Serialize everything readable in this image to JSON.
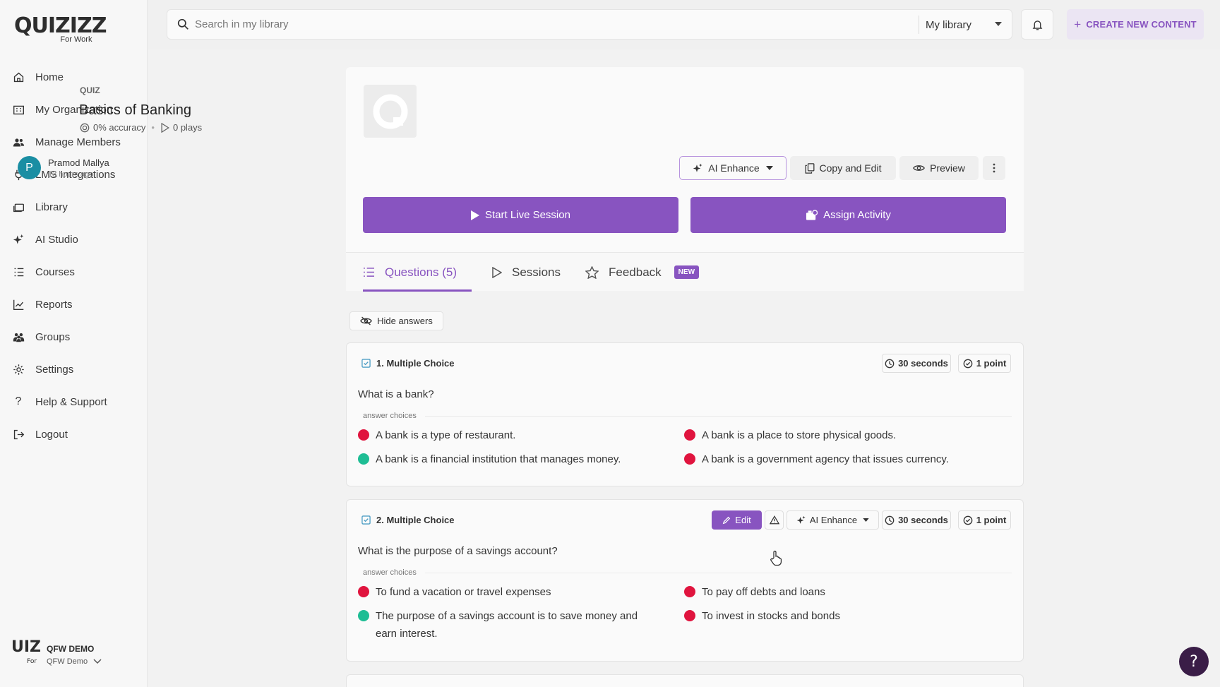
{
  "brand": {
    "logo": "QUIZIZZ",
    "subtitle": "For Work"
  },
  "sidebar": {
    "items": [
      {
        "label": "Home",
        "icon": "home-icon"
      },
      {
        "label": "My Organization",
        "icon": "organization-icon"
      },
      {
        "label": "Manage Members",
        "icon": "members-icon"
      },
      {
        "label": "LMS Integrations",
        "icon": "plug-icon"
      },
      {
        "label": "Library",
        "icon": "library-icon"
      },
      {
        "label": "AI Studio",
        "icon": "sparkle-icon"
      },
      {
        "label": "Courses",
        "icon": "courses-icon"
      },
      {
        "label": "Reports",
        "icon": "chart-icon"
      },
      {
        "label": "Groups",
        "icon": "groups-icon"
      },
      {
        "label": "Settings",
        "icon": "gear-icon"
      },
      {
        "label": "Help & Support",
        "icon": "question-icon"
      },
      {
        "label": "Logout",
        "icon": "logout-icon"
      }
    ],
    "org": {
      "logo": "UIZI",
      "logo_sub": "For",
      "name": "QFW DEMO",
      "account": "QFW Demo"
    }
  },
  "topbar": {
    "search_placeholder": "Search in my library",
    "scope": "My library",
    "create_label": "CREATE NEW CONTENT"
  },
  "quiz": {
    "type": "QUIZ",
    "title": "Basics of Banking",
    "accuracy": "0% accuracy",
    "plays": "0 plays",
    "author_initial": "P",
    "author": "Pramod Mallya",
    "updated": "13 hours ago",
    "ai_enhance": "AI Enhance",
    "copy_edit": "Copy and Edit",
    "preview": "Preview",
    "start_live": "Start Live Session",
    "assign": "Assign Activity"
  },
  "tabs": {
    "questions": "Questions (5)",
    "sessions": "Sessions",
    "feedback": "Feedback",
    "new_badge": "NEW"
  },
  "hide_answers": "Hide answers",
  "questions": [
    {
      "header": "1. Multiple Choice",
      "time": "30 seconds",
      "points": "1 point",
      "text": "What is a bank?",
      "choices_label": "answer choices",
      "choices": [
        {
          "text": "A bank is a type of restaurant.",
          "correct": false
        },
        {
          "text": "A bank is a place to store physical goods.",
          "correct": false
        },
        {
          "text": "A bank is a financial institution that manages money.",
          "correct": true
        },
        {
          "text": "A bank is a government agency that issues currency.",
          "correct": false
        }
      ]
    },
    {
      "header": "2. Multiple Choice",
      "edit": "Edit",
      "ai_enhance": "AI Enhance",
      "time": "30 seconds",
      "points": "1 point",
      "text": "What is the purpose of a savings account?",
      "choices_label": "answer choices",
      "choices": [
        {
          "text": "To fund a vacation or travel expenses",
          "correct": false
        },
        {
          "text": "To pay off debts and loans",
          "correct": false
        },
        {
          "text": "The purpose of a savings account is to save money and earn interest.",
          "correct": true
        },
        {
          "text": "To invest in stocks and bonds",
          "correct": false
        }
      ]
    }
  ],
  "help_fab": "?",
  "colors": {
    "primary": "#8854c0",
    "correct": "#1ebd94",
    "incorrect": "#e0143e",
    "avatar": "#1a8ea3"
  }
}
